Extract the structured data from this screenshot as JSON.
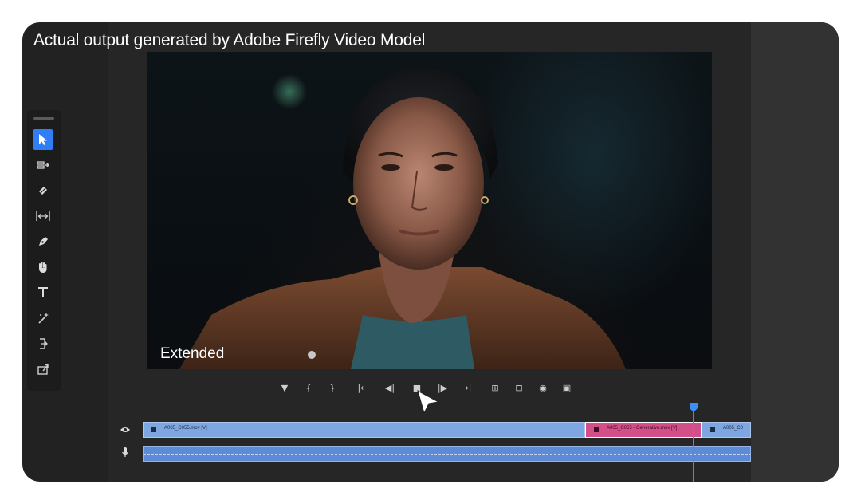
{
  "caption": "Actual output generated by Adobe Firefly Video Model",
  "video": {
    "label": "Extended"
  },
  "tools": [
    {
      "name": "selection-tool",
      "icon": "arrow-pointer-icon",
      "active": true
    },
    {
      "name": "track-select-tool",
      "icon": "track-select-forward-icon",
      "active": false
    },
    {
      "name": "razor-tool",
      "icon": "razor-icon",
      "active": false
    },
    {
      "name": "slip-tool",
      "icon": "slip-icon",
      "active": false
    },
    {
      "name": "pen-tool",
      "icon": "pen-icon",
      "active": false
    },
    {
      "name": "hand-tool",
      "icon": "hand-icon",
      "active": false
    },
    {
      "name": "type-tool",
      "icon": "type-icon",
      "active": false
    },
    {
      "name": "generative-extend-tool",
      "icon": "magic-wand-icon",
      "active": false
    },
    {
      "name": "ripple-edit-tool",
      "icon": "ripple-edit-icon",
      "active": false
    },
    {
      "name": "export-frame-tool",
      "icon": "export-icon",
      "active": false
    }
  ],
  "transport": [
    {
      "name": "add-marker-button",
      "glyph": "▼"
    },
    {
      "name": "mark-in-button",
      "glyph": "{"
    },
    {
      "name": "mark-out-button",
      "glyph": "}"
    },
    {
      "name": "go-to-in-button",
      "glyph": "|←"
    },
    {
      "name": "step-back-button",
      "glyph": "◀|"
    },
    {
      "name": "play-stop-button",
      "glyph": "■"
    },
    {
      "name": "step-forward-button",
      "glyph": "|▶"
    },
    {
      "name": "go-to-out-button",
      "glyph": "→|"
    },
    {
      "name": "insert-button",
      "glyph": "⊞"
    },
    {
      "name": "overwrite-button",
      "glyph": "⊟"
    },
    {
      "name": "export-frame-button",
      "glyph": "◉"
    },
    {
      "name": "comparison-view-button",
      "glyph": "▣"
    }
  ],
  "timeline": {
    "video_track_icon": "eye-icon",
    "audio_track_icon": "microphone-icon",
    "clips": {
      "v1": "A005_C055.mov [V]",
      "v2": "A005_C055 - Generative.mov [V]",
      "v3": "A005_C0",
      "a1": ""
    }
  },
  "colors": {
    "accent": "#2f7ef7",
    "video_clip": "#7ea6e0",
    "generated_clip": "#d24f8a",
    "audio_clip": "#5f8bd6",
    "playhead": "#3e8ef7"
  }
}
